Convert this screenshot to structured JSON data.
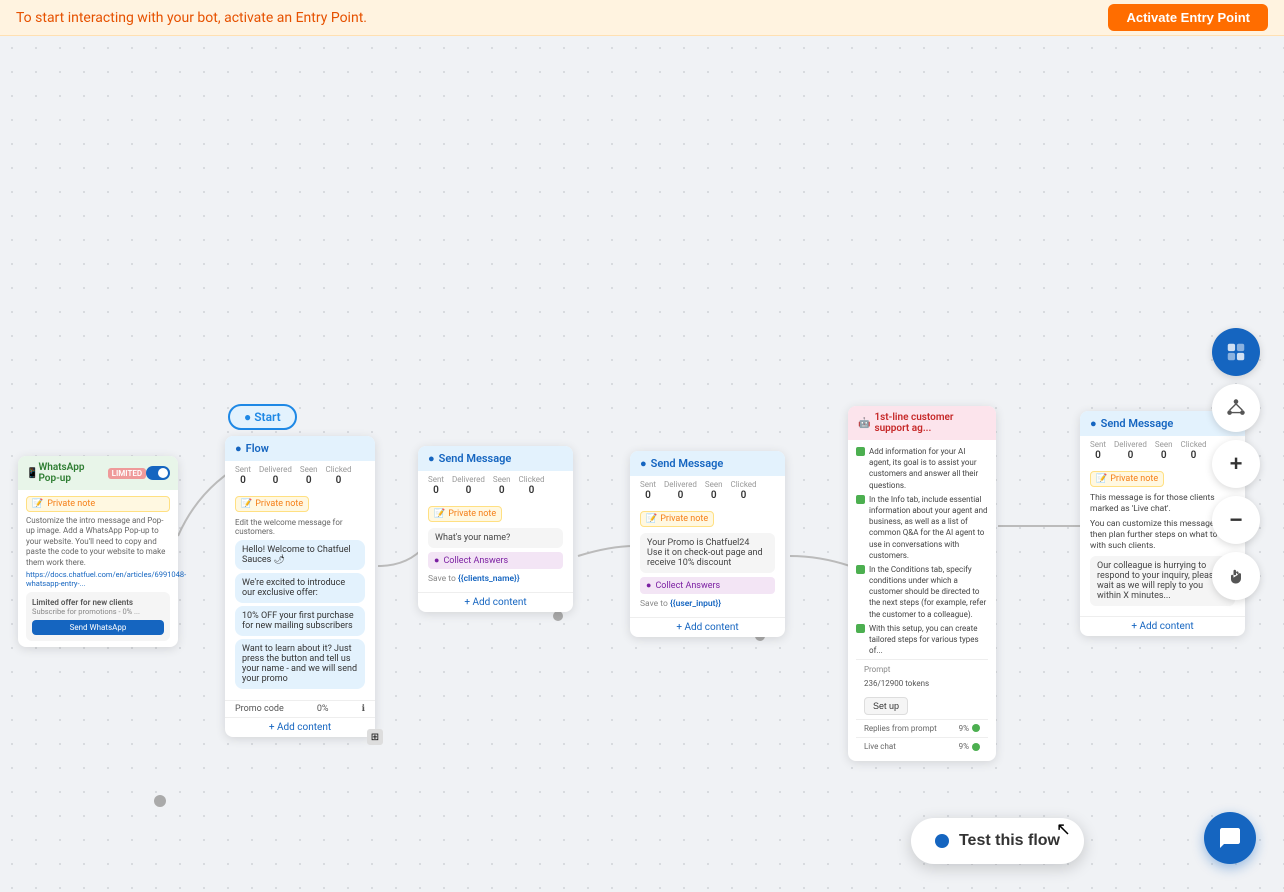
{
  "banner": {
    "text": "To start interacting with your bot, activate an Entry Point.",
    "button_label": "Activate Entry Point"
  },
  "toolbar": {
    "back_icon": "←",
    "network_icon": "⊞",
    "zoom_in_label": "+",
    "zoom_out_label": "−",
    "hand_icon": "✋"
  },
  "start_node": {
    "label": "Start"
  },
  "whatsapp_node": {
    "header": "WhatsApp Pop-up",
    "badge": "LIMITED",
    "private_note": "Private note",
    "note_text": "Customize the intro message and Pop-up image. Add a WhatsApp Pop-up to your website. You'll need to copy and paste the code to your website to make them work there.",
    "link": "https://docs.chatfuel.com/en/articles/6991048-whatsapp-entry-...",
    "preview_text": "Limited offer for new clients",
    "preview_subtext": "Subscribe for promotions - 0% ...",
    "button_label": "Send WhatsApp"
  },
  "flow_node": {
    "header": "Flow",
    "stats": [
      {
        "label": "Sent",
        "value": "0"
      },
      {
        "label": "Delivered",
        "value": "0"
      },
      {
        "label": "Seen",
        "value": "0"
      },
      {
        "label": "Clicked",
        "value": "0"
      }
    ],
    "private_note": "Private note",
    "note_text": "Edit the welcome message for customers.",
    "bubble1": "Hello! Welcome to Chatfuel Sauces 🌶",
    "bubble2": "We're excited to introduce our exclusive offer:",
    "bubble3": "10% OFF your first purchase for new mailing subscribers",
    "bubble4": "Want to learn about it? Just press the button and tell us your name - and we will send your promo",
    "promo_label": "Promo code",
    "promo_value": "0%",
    "add_content": "+ Add content"
  },
  "send_msg_node1": {
    "header": "Send Message",
    "stats": [
      {
        "label": "Sent",
        "value": "0"
      },
      {
        "label": "Delivered",
        "value": "0"
      },
      {
        "label": "Seen",
        "value": "0"
      },
      {
        "label": "Clicked",
        "value": "0"
      }
    ],
    "private_note": "Private note",
    "msg": "What's your name?",
    "collect_label": "Collect Answers",
    "save_to": "Save to",
    "var_name": "{{clients_name}}",
    "add_content": "+ Add content"
  },
  "send_msg_node2": {
    "header": "Send Message",
    "stats": [
      {
        "label": "Sent",
        "value": "0"
      },
      {
        "label": "Delivered",
        "value": "0"
      },
      {
        "label": "Seen",
        "value": "0"
      },
      {
        "label": "Clicked",
        "value": "0"
      }
    ],
    "private_note": "Private note",
    "msg1": "Your Promo is Chatfuel24",
    "msg2": "Use it on check-out page and receive 10% discount",
    "collect_label": "Collect Answers",
    "save_to": "Save to",
    "var_name": "{{user_input}}",
    "add_content": "+ Add content"
  },
  "ai_node": {
    "header": "1st-line customer support ag...",
    "items": [
      "Add information for your AI agent, its goal is to assist your customers and answer all their questions.",
      "In the Info tab, include essential information about your agent and business, as well as a list of common Q&A for the AI agent to use in conversations with customers.",
      "In the Conditions tab, specify conditions under which a customer should be directed to the next steps (for example, refer the customer to a colleague).",
      "With this setup, you can create tailored steps for various types of..."
    ],
    "prompt_label": "Prompt",
    "tokens": "236/12900 tokens",
    "setup_btn": "Set up",
    "replies_label": "Replies from prompt",
    "replies_val": "9%",
    "live_label": "Live chat",
    "live_val": "9%"
  },
  "right_send_node": {
    "header": "Send Message",
    "stats": [
      {
        "label": "Sent",
        "value": "0"
      },
      {
        "label": "Delivered",
        "value": "0"
      },
      {
        "label": "Seen",
        "value": "0"
      },
      {
        "label": "Clicked",
        "value": "0"
      }
    ],
    "private_note": "Private note",
    "note_text1": "This message is for those clients marked as 'Live chat'.",
    "note_text2": "You can customize this message and then plan further steps on what to do with such clients.",
    "msg": "Our colleague is hurrying to respond to your inquiry, please wait as we will reply to you within X minutes...",
    "add_content": "+ Add content"
  },
  "test_flow_btn": {
    "label": "Test this flow"
  },
  "chat_support_btn": {
    "icon": "💬"
  }
}
